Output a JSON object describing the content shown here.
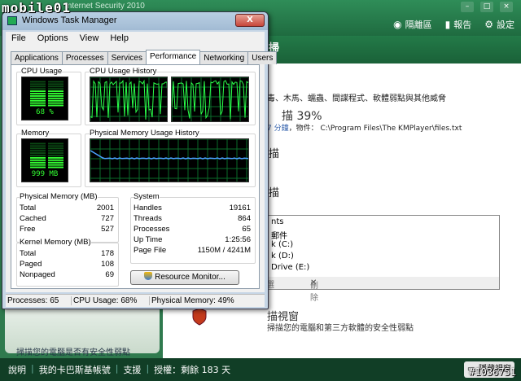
{
  "watermark": {
    "top_left": "mobile01",
    "bottom_right": "#1036751"
  },
  "background_app": {
    "title": "Internet Security 2010",
    "toolbar": [
      {
        "icon": "globe-icon",
        "label": "隔離區"
      },
      {
        "icon": "bar-chart-icon",
        "label": "報告"
      },
      {
        "icon": "gear-icon",
        "label": "設定"
      }
    ],
    "header_main": "掃",
    "header_sub": "描",
    "description": "毒、木馬、蠕蟲、間諜程式、軟體弱點與其他威脅",
    "scan_progress": "描 39%",
    "path_prefix": "7 分鐘",
    "path_object_label": "，物件：",
    "path_value": "C:\\Program Files\\The KMPlayer\\files.txt",
    "scan_line_2": "描",
    "scan_line_3": "描",
    "list_items": [
      "nts",
      "郵件",
      "k (C:)",
      "k (D:)",
      "Drive (E:)"
    ],
    "list_bar_left": "選",
    "list_bar_delete": "刪除",
    "footer_title": "描視窗",
    "footer_desc": "掃描您的電腦和第三方軟體的安全性弱點",
    "left_panel_text": "掃描您的電腦是否有安全性弱點",
    "status_items": [
      "說明",
      "我的卡巴斯基帳號",
      "支援",
      "授權：剩餘 183 天"
    ],
    "status_button": "隱藏視窗"
  },
  "task_manager": {
    "title": "Windows Task Manager",
    "close_label": "X",
    "menu": [
      "File",
      "Options",
      "View",
      "Help"
    ],
    "tabs": [
      "Applications",
      "Processes",
      "Services",
      "Performance",
      "Networking",
      "Users"
    ],
    "active_tab": "Performance",
    "cpu_usage_label": "CPU Usage",
    "cpu_usage_value": "68 %",
    "cpu_usage_percent": 68,
    "cpu_history_label": "CPU Usage History",
    "memory_label": "Memory",
    "memory_value": "999 MB",
    "memory_percent": 49,
    "memory_history_label": "Physical Memory Usage History",
    "physical_memory": {
      "label": "Physical Memory (MB)",
      "rows": [
        {
          "k": "Total",
          "v": "2001"
        },
        {
          "k": "Cached",
          "v": "727"
        },
        {
          "k": "Free",
          "v": "527"
        }
      ]
    },
    "kernel_memory": {
      "label": "Kernel Memory (MB)",
      "rows": [
        {
          "k": "Total",
          "v": "178"
        },
        {
          "k": "Paged",
          "v": "108"
        },
        {
          "k": "Nonpaged",
          "v": "69"
        }
      ]
    },
    "system": {
      "label": "System",
      "rows": [
        {
          "k": "Handles",
          "v": "19161"
        },
        {
          "k": "Threads",
          "v": "864"
        },
        {
          "k": "Processes",
          "v": "65"
        },
        {
          "k": "Up Time",
          "v": "1:25:56"
        },
        {
          "k": "Page File",
          "v": "1150M / 4241M"
        }
      ]
    },
    "resource_monitor_button": "Resource Monitor...",
    "status": {
      "processes": "Processes: 65",
      "cpu": "CPU Usage: 68%",
      "memory": "Physical Memory: 49%"
    },
    "colors": {
      "meter_green": "#33ff33",
      "grid_green": "#0a6b2a",
      "cpu_line": "#2aff4a",
      "mem_line": "#4aa0ff"
    }
  }
}
